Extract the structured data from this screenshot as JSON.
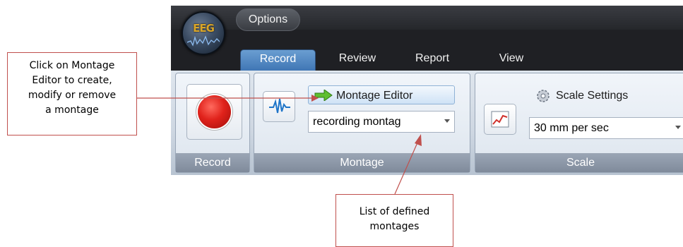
{
  "app": {
    "logo_text": "EEG",
    "menu_button": "Options",
    "tabs": [
      {
        "label": "Record",
        "active": true
      },
      {
        "label": "Review",
        "active": false
      },
      {
        "label": "Report",
        "active": false
      },
      {
        "label": "View",
        "active": false
      }
    ],
    "groups": {
      "record": {
        "label": "Record"
      },
      "montage": {
        "label": "Montage",
        "editor_button": "Montage Editor",
        "selected_montage": "recording montag"
      },
      "scale": {
        "label": "Scale",
        "settings_button": "Scale Settings",
        "selected_scale": "30 mm per sec"
      }
    }
  },
  "callouts": {
    "montage_editor": [
      "Click on Montage",
      "Editor to create,",
      "modify or remove",
      "a montage"
    ],
    "montage_list": [
      "List of defined",
      "montages"
    ]
  },
  "colors": {
    "callout_border": "#c0504d",
    "record_red": "#e0221b",
    "active_tab": "#4f86c6"
  }
}
